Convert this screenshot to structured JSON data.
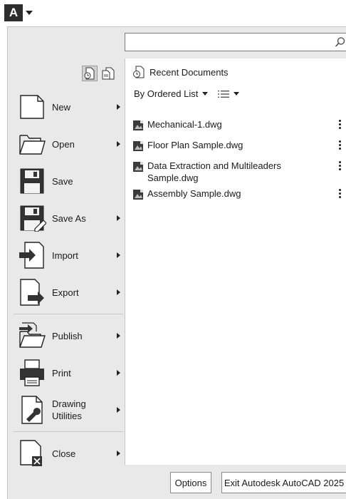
{
  "app": {
    "logo_letter": "A",
    "accent": "#2d2d2d"
  },
  "search": {
    "placeholder": "",
    "value": ""
  },
  "menu": {
    "items": [
      {
        "label": "New",
        "has_submenu": true,
        "icon": "new-document-icon"
      },
      {
        "label": "Open",
        "has_submenu": true,
        "icon": "open-folder-icon"
      },
      {
        "label": "Save",
        "has_submenu": false,
        "icon": "save-disk-icon"
      },
      {
        "label": "Save As",
        "has_submenu": true,
        "icon": "save-as-icon"
      },
      {
        "label": "Import",
        "has_submenu": true,
        "icon": "import-icon"
      },
      {
        "label": "Export",
        "has_submenu": true,
        "icon": "export-icon"
      },
      {
        "label": "Publish",
        "has_submenu": true,
        "icon": "publish-icon"
      },
      {
        "label": "Print",
        "has_submenu": true,
        "icon": "printer-icon"
      },
      {
        "label_line1": "Drawing",
        "label_line2": "Utilities",
        "has_submenu": true,
        "icon": "drawing-utilities-icon"
      },
      {
        "label": "Close",
        "has_submenu": true,
        "icon": "close-document-icon"
      }
    ]
  },
  "recent": {
    "header": "Recent Documents",
    "order_label": "By Ordered List",
    "files": [
      {
        "name": "Mechanical-1.dwg"
      },
      {
        "name": "Floor Plan Sample.dwg"
      },
      {
        "name": "Data Extraction and Multileaders Sample.dwg"
      },
      {
        "name": "Assembly Sample.dwg"
      }
    ]
  },
  "footer": {
    "options_label": "Options",
    "exit_label": "Exit Autodesk AutoCAD 2025"
  }
}
